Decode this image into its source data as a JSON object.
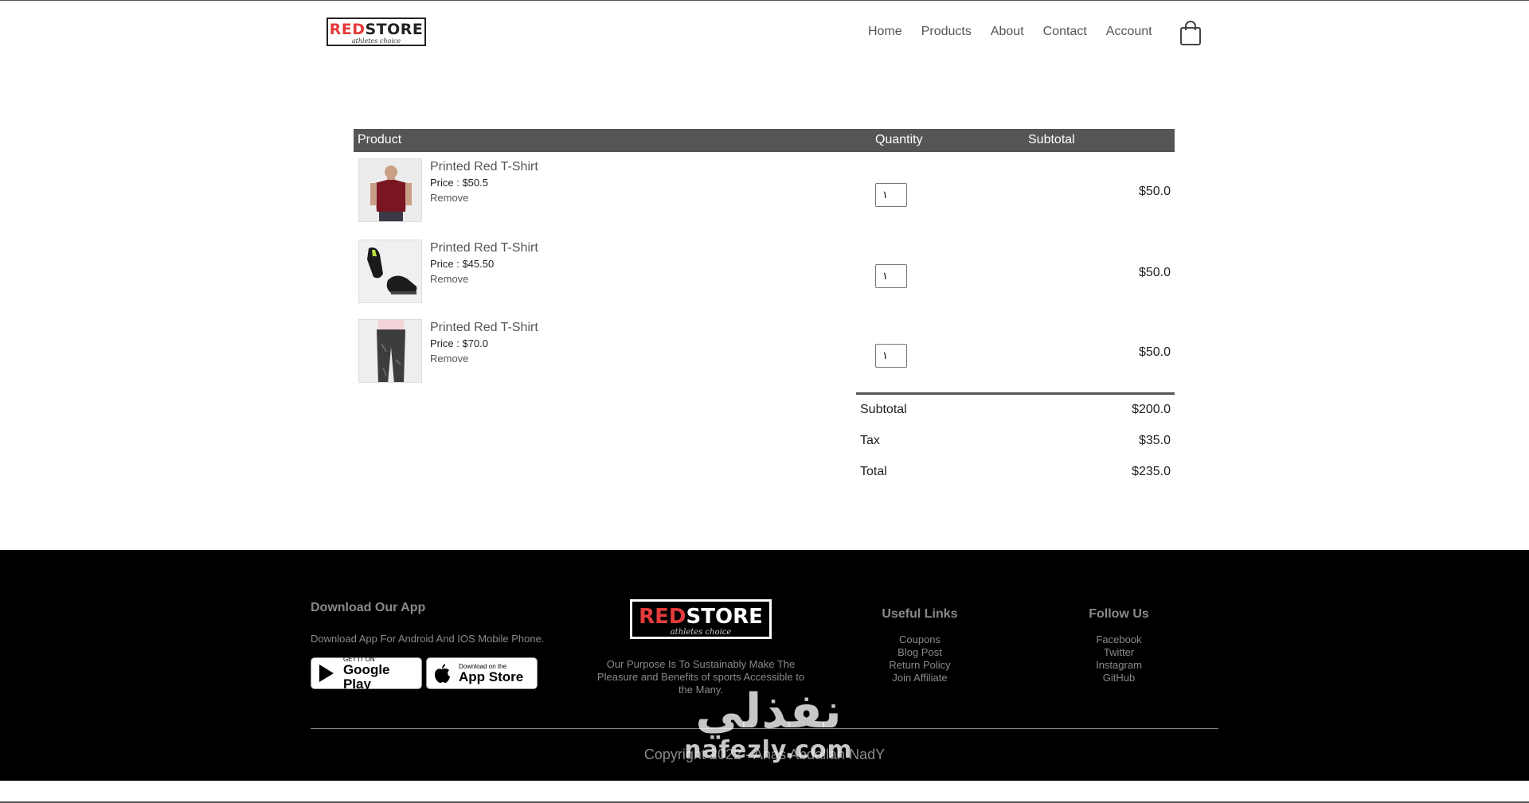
{
  "header": {
    "logo": {
      "brand_red": "RED",
      "brand_dark": "STORE",
      "tagline": "athletes choice"
    },
    "nav": [
      "Home",
      "Products",
      "About",
      "Contact",
      "Account"
    ],
    "cart_icon": "shopping-bag-icon"
  },
  "cart": {
    "columns": {
      "product": "Product",
      "quantity": "Quantity",
      "subtotal": "Subtotal"
    },
    "items": [
      {
        "name": "Printed Red T-Shirt",
        "price": "Price : $50.5",
        "remove": "Remove",
        "quantity": "١",
        "subtotal": "$50.0",
        "image": "red-tshirt"
      },
      {
        "name": "Printed Red T-Shirt",
        "price": "Price : $45.50",
        "remove": "Remove",
        "quantity": "١",
        "subtotal": "$50.0",
        "image": "black-shoes"
      },
      {
        "name": "Printed Red T-Shirt",
        "price": "Price : $70.0",
        "remove": "Remove",
        "quantity": "١",
        "subtotal": "$50.0",
        "image": "grey-joggers"
      }
    ],
    "totals": [
      {
        "label": "Subtotal",
        "value": "$200.0"
      },
      {
        "label": "Tax",
        "value": "$35.0"
      },
      {
        "label": "Total",
        "value": "$235.0"
      }
    ]
  },
  "footer": {
    "app": {
      "title": "Download Our App",
      "text": "Download App For Android And IOS Mobile Phone.",
      "google": {
        "small": "GET IT ON",
        "big": "Google Play"
      },
      "apple": {
        "small": "Download on the",
        "big": "App Store"
      }
    },
    "about": {
      "logo": {
        "brand_red": "RED",
        "brand_white": "STORE",
        "tagline": "athletes choice"
      },
      "text": "Our Purpose Is To Sustainably Make The Pleasure and Benefits of sports Accessible to the Many."
    },
    "useful_links": {
      "title": "Useful Links",
      "items": [
        "Coupons",
        "Blog Post",
        "Return Policy",
        "Join Affiliate"
      ]
    },
    "follow_us": {
      "title": "Follow Us",
      "items": [
        "Facebook",
        "Twitter",
        "Instagram",
        "GitHub"
      ]
    },
    "copyright": "Copyright 2022 - Anas Abdallah NadY"
  },
  "watermark": {
    "arabic": "نفذلي",
    "latin": "nafezly.com"
  }
}
